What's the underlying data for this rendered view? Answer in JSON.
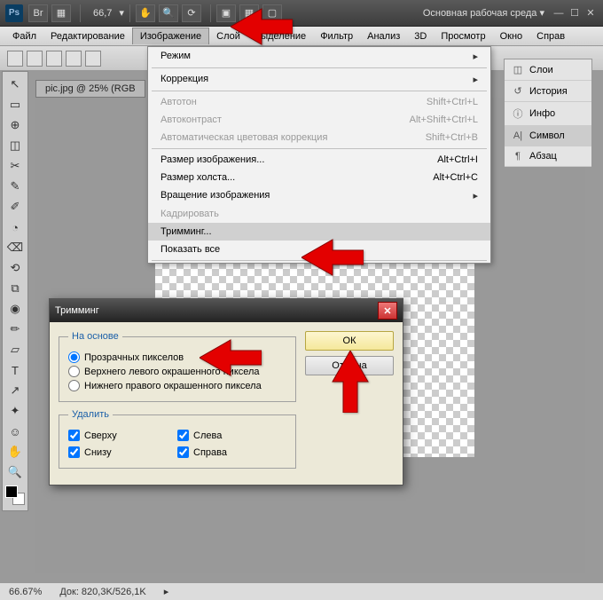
{
  "chrome": {
    "ps": "Ps",
    "zoom": "66,7",
    "workspace": "Основная рабочая среда ▾"
  },
  "menubar": [
    "Файл",
    "Редактирование",
    "Изображение",
    "Слой",
    "Выделение",
    "Фильтр",
    "Анализ",
    "3D",
    "Просмотр",
    "Окно",
    "Справ"
  ],
  "doc_tab": "pic.jpg @ 25% (RGB",
  "dropdown": {
    "mode": "Режим",
    "correction": "Коррекция",
    "autotone": "Автотон",
    "autotone_sc": "Shift+Ctrl+L",
    "autocontrast": "Автоконтраст",
    "autocontrast_sc": "Alt+Shift+Ctrl+L",
    "autocolor": "Автоматическая цветовая коррекция",
    "autocolor_sc": "Shift+Ctrl+B",
    "imgsize": "Размер изображения...",
    "imgsize_sc": "Alt+Ctrl+I",
    "canvassize": "Размер холста...",
    "canvassize_sc": "Alt+Ctrl+C",
    "rotation": "Вращение изображения",
    "crop": "Кадрировать",
    "trim": "Тримминг...",
    "revealall": "Показать все"
  },
  "sidepanel": {
    "layers": "Слои",
    "history": "История",
    "info": "Инфо",
    "symbol": "Символ",
    "paragraph": "Абзац"
  },
  "dialog": {
    "title": "Тримминг",
    "basis_legend": "На основе",
    "opt_transparent": "Прозрачных пикселов",
    "opt_topleft": "Верхнего левого окрашенного пиксела",
    "opt_botright": "Нижнего правого окрашенного пиксела",
    "delete_legend": "Удалить",
    "chk_top": "Сверху",
    "chk_bottom": "Снизу",
    "chk_left": "Слева",
    "chk_right": "Справа",
    "ok": "ОК",
    "cancel": "Отмена"
  },
  "status": {
    "zoom": "66.67%",
    "doc": "Док: 820,3K/526,1K"
  },
  "tools": [
    "↖",
    "▭",
    "⊕",
    "◫",
    "✂",
    "✎",
    "✐",
    "◔",
    "⌫",
    "⟲",
    "⧉",
    "◉",
    "✏",
    "▱",
    "T",
    "↗",
    "✦",
    "☺",
    "✋",
    "🔍"
  ]
}
